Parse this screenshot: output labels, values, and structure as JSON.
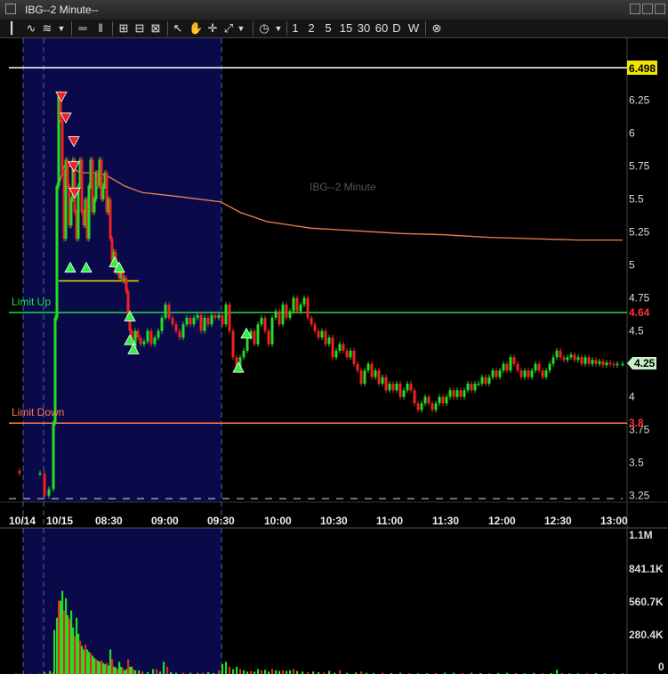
{
  "window": {
    "title": "IBG--2 Minute--"
  },
  "toolbar": {
    "intervals": [
      "1",
      "2",
      "5",
      "15",
      "30",
      "60",
      "D",
      "W"
    ]
  },
  "chart_data": {
    "type": "candlestick",
    "watermark": "IBG--2 Minute",
    "price_axis": {
      "ticks": [
        "6.25",
        "6",
        "5.75",
        "5.5",
        "5.25",
        "5",
        "4.75",
        "4.5",
        "4.25",
        "4",
        "3.75",
        "3.5",
        "3.25"
      ],
      "range": [
        3.2,
        6.55
      ]
    },
    "time_axis": {
      "labels": [
        "10/14",
        "10/15",
        "08:30",
        "09:00",
        "09:30",
        "10:00",
        "10:30",
        "11:00",
        "11:30",
        "12:00",
        "12:30",
        "13:00"
      ]
    },
    "volume_axis": {
      "ticks": [
        "1.1M",
        "841.1K",
        "560.7K",
        "280.4K",
        "0"
      ],
      "max": 1100000
    },
    "levels": {
      "high": {
        "value": 6.498,
        "label": "6.498",
        "color": "#ffffff"
      },
      "limit_up": {
        "value": 4.64,
        "label": "4.64",
        "name": "Limit Up",
        "color": "#22dd44"
      },
      "limit_down": {
        "value": 3.8,
        "label": "3.8",
        "name": "Limit Down",
        "color": "#ff7a4a"
      },
      "last": {
        "value": 4.25,
        "label": "4.25"
      }
    },
    "price_path": [
      [
        10,
        3.44
      ],
      [
        22,
        3.42
      ],
      [
        45,
        3.42
      ],
      [
        50,
        3.25
      ],
      [
        55,
        3.3
      ],
      [
        60,
        3.8
      ],
      [
        62,
        4.6
      ],
      [
        64,
        5.6
      ],
      [
        66,
        6.3
      ],
      [
        68,
        6.1
      ],
      [
        70,
        5.7
      ],
      [
        72,
        5.2
      ],
      [
        74,
        5.8
      ],
      [
        76,
        5.6
      ],
      [
        78,
        5.3
      ],
      [
        80,
        5.5
      ],
      [
        82,
        5.8
      ],
      [
        84,
        5.4
      ],
      [
        86,
        5.2
      ],
      [
        88,
        5.6
      ],
      [
        90,
        5.8
      ],
      [
        92,
        5.4
      ],
      [
        94,
        5.3
      ],
      [
        96,
        5.5
      ],
      [
        98,
        5.2
      ],
      [
        100,
        5.6
      ],
      [
        102,
        5.8
      ],
      [
        104,
        5.4
      ],
      [
        106,
        5.5
      ],
      [
        108,
        5.7
      ],
      [
        110,
        5.6
      ],
      [
        112,
        5.8
      ],
      [
        114,
        5.5
      ],
      [
        116,
        5.6
      ],
      [
        118,
        5.7
      ],
      [
        120,
        5.4
      ],
      [
        122,
        5.5
      ],
      [
        124,
        5.2
      ],
      [
        126,
        5.0
      ],
      [
        128,
        5.1
      ],
      [
        130,
        4.95
      ],
      [
        132,
        5.0
      ],
      [
        134,
        4.9
      ],
      [
        136,
        4.95
      ],
      [
        138,
        4.88
      ],
      [
        140,
        4.9
      ],
      [
        142,
        4.8
      ],
      [
        144,
        4.6
      ],
      [
        146,
        4.5
      ],
      [
        148,
        4.4
      ],
      [
        150,
        4.35
      ],
      [
        152,
        4.5
      ],
      [
        155,
        4.45
      ],
      [
        158,
        4.4
      ],
      [
        162,
        4.42
      ],
      [
        166,
        4.5
      ],
      [
        170,
        4.4
      ],
      [
        174,
        4.45
      ],
      [
        178,
        4.5
      ],
      [
        182,
        4.6
      ],
      [
        186,
        4.7
      ],
      [
        190,
        4.6
      ],
      [
        194,
        4.55
      ],
      [
        198,
        4.5
      ],
      [
        202,
        4.45
      ],
      [
        206,
        4.55
      ],
      [
        210,
        4.6
      ],
      [
        214,
        4.55
      ],
      [
        218,
        4.6
      ],
      [
        222,
        4.62
      ],
      [
        226,
        4.5
      ],
      [
        230,
        4.6
      ],
      [
        234,
        4.55
      ],
      [
        238,
        4.62
      ],
      [
        242,
        4.6
      ],
      [
        246,
        4.62
      ],
      [
        250,
        4.55
      ],
      [
        254,
        4.7
      ],
      [
        258,
        4.5
      ],
      [
        262,
        4.3
      ],
      [
        266,
        4.2
      ],
      [
        270,
        4.3
      ],
      [
        274,
        4.35
      ],
      [
        278,
        4.45
      ],
      [
        282,
        4.5
      ],
      [
        286,
        4.4
      ],
      [
        290,
        4.55
      ],
      [
        294,
        4.6
      ],
      [
        298,
        4.5
      ],
      [
        302,
        4.4
      ],
      [
        306,
        4.6
      ],
      [
        310,
        4.65
      ],
      [
        314,
        4.55
      ],
      [
        318,
        4.7
      ],
      [
        322,
        4.6
      ],
      [
        326,
        4.65
      ],
      [
        330,
        4.75
      ],
      [
        334,
        4.65
      ],
      [
        338,
        4.7
      ],
      [
        342,
        4.75
      ],
      [
        346,
        4.6
      ],
      [
        350,
        4.55
      ],
      [
        354,
        4.5
      ],
      [
        358,
        4.45
      ],
      [
        362,
        4.5
      ],
      [
        366,
        4.4
      ],
      [
        370,
        4.45
      ],
      [
        374,
        4.3
      ],
      [
        378,
        4.35
      ],
      [
        382,
        4.4
      ],
      [
        386,
        4.35
      ],
      [
        390,
        4.3
      ],
      [
        394,
        4.35
      ],
      [
        398,
        4.25
      ],
      [
        402,
        4.2
      ],
      [
        406,
        4.1
      ],
      [
        410,
        4.2
      ],
      [
        414,
        4.25
      ],
      [
        418,
        4.15
      ],
      [
        422,
        4.2
      ],
      [
        426,
        4.1
      ],
      [
        430,
        4.15
      ],
      [
        434,
        4.05
      ],
      [
        438,
        4.1
      ],
      [
        442,
        4.05
      ],
      [
        446,
        4.1
      ],
      [
        450,
        4.0
      ],
      [
        454,
        4.05
      ],
      [
        458,
        4.1
      ],
      [
        462,
        4.05
      ],
      [
        466,
        3.95
      ],
      [
        470,
        3.9
      ],
      [
        474,
        3.95
      ],
      [
        478,
        4.0
      ],
      [
        482,
        3.95
      ],
      [
        486,
        3.9
      ],
      [
        490,
        3.95
      ],
      [
        494,
        4.0
      ],
      [
        498,
        3.95
      ],
      [
        502,
        4.0
      ],
      [
        506,
        4.05
      ],
      [
        510,
        4.0
      ],
      [
        514,
        4.05
      ],
      [
        518,
        4.0
      ],
      [
        522,
        4.05
      ],
      [
        526,
        4.1
      ],
      [
        530,
        4.05
      ],
      [
        534,
        4.1
      ],
      [
        538,
        4.1
      ],
      [
        542,
        4.15
      ],
      [
        546,
        4.1
      ],
      [
        550,
        4.15
      ],
      [
        554,
        4.2
      ],
      [
        558,
        4.15
      ],
      [
        562,
        4.2
      ],
      [
        566,
        4.25
      ],
      [
        570,
        4.2
      ],
      [
        574,
        4.3
      ],
      [
        578,
        4.25
      ],
      [
        582,
        4.2
      ],
      [
        586,
        4.15
      ],
      [
        590,
        4.2
      ],
      [
        594,
        4.15
      ],
      [
        598,
        4.2
      ],
      [
        602,
        4.25
      ],
      [
        606,
        4.2
      ],
      [
        610,
        4.15
      ],
      [
        614,
        4.2
      ],
      [
        618,
        4.25
      ],
      [
        622,
        4.3
      ],
      [
        626,
        4.35
      ],
      [
        630,
        4.3
      ],
      [
        634,
        4.28
      ],
      [
        638,
        4.3
      ],
      [
        642,
        4.32
      ],
      [
        646,
        4.28
      ],
      [
        650,
        4.3
      ],
      [
        654,
        4.25
      ],
      [
        658,
        4.3
      ],
      [
        662,
        4.25
      ],
      [
        666,
        4.28
      ],
      [
        670,
        4.25
      ],
      [
        674,
        4.27
      ],
      [
        678,
        4.24
      ],
      [
        682,
        4.26
      ],
      [
        686,
        4.25
      ],
      [
        690,
        4.24
      ],
      [
        694,
        4.25
      ],
      [
        700,
        4.25
      ]
    ],
    "vwap_path": [
      [
        66,
        5.6
      ],
      [
        72,
        5.75
      ],
      [
        80,
        5.75
      ],
      [
        90,
        5.7
      ],
      [
        100,
        5.7
      ],
      [
        110,
        5.7
      ],
      [
        120,
        5.68
      ],
      [
        140,
        5.6
      ],
      [
        160,
        5.55
      ],
      [
        200,
        5.52
      ],
      [
        248,
        5.48
      ],
      [
        270,
        5.4
      ],
      [
        300,
        5.33
      ],
      [
        350,
        5.28
      ],
      [
        400,
        5.26
      ],
      [
        450,
        5.24
      ],
      [
        500,
        5.23
      ],
      [
        550,
        5.21
      ],
      [
        600,
        5.2
      ],
      [
        650,
        5.19
      ],
      [
        700,
        5.19
      ]
    ],
    "buy_signals": [
      [
        79,
        4.98
      ],
      [
        97,
        4.98
      ],
      [
        129,
        5.02
      ],
      [
        134,
        4.98
      ],
      [
        146,
        4.61
      ],
      [
        146,
        4.43
      ],
      [
        150,
        4.36
      ],
      [
        268,
        4.22
      ],
      [
        277,
        4.48
      ]
    ],
    "sell_signals": [
      [
        69,
        6.28
      ],
      [
        74,
        6.12
      ],
      [
        83,
        5.94
      ],
      [
        83,
        5.75
      ],
      [
        84,
        5.55
      ]
    ],
    "volume_bars": [
      [
        18,
        3
      ],
      [
        22,
        2
      ],
      [
        26,
        2
      ],
      [
        34,
        2
      ],
      [
        44,
        3
      ],
      [
        50,
        12
      ],
      [
        56,
        25
      ],
      [
        59,
        12
      ],
      [
        61,
        360
      ],
      [
        64,
        460
      ],
      [
        66,
        600
      ],
      [
        68,
        600
      ],
      [
        70,
        680
      ],
      [
        72,
        520
      ],
      [
        74,
        620
      ],
      [
        76,
        480
      ],
      [
        78,
        450
      ],
      [
        80,
        520
      ],
      [
        82,
        380
      ],
      [
        84,
        310
      ],
      [
        86,
        460
      ],
      [
        88,
        330
      ],
      [
        90,
        270
      ],
      [
        92,
        230
      ],
      [
        94,
        200
      ],
      [
        96,
        240
      ],
      [
        98,
        200
      ],
      [
        100,
        180
      ],
      [
        102,
        170
      ],
      [
        104,
        150
      ],
      [
        106,
        130
      ],
      [
        108,
        120
      ],
      [
        110,
        110
      ],
      [
        112,
        100
      ],
      [
        114,
        110
      ],
      [
        116,
        90
      ],
      [
        118,
        80
      ],
      [
        120,
        90
      ],
      [
        122,
        70
      ],
      [
        124,
        200
      ],
      [
        126,
        120
      ],
      [
        128,
        60
      ],
      [
        130,
        55
      ],
      [
        132,
        40
      ],
      [
        134,
        100
      ],
      [
        136,
        60
      ],
      [
        138,
        50
      ],
      [
        140,
        30
      ],
      [
        142,
        40
      ],
      [
        144,
        120
      ],
      [
        146,
        60
      ],
      [
        148,
        60
      ],
      [
        150,
        40
      ],
      [
        152,
        30
      ],
      [
        156,
        30
      ],
      [
        160,
        20
      ],
      [
        166,
        15
      ],
      [
        172,
        40
      ],
      [
        176,
        40
      ],
      [
        180,
        20
      ],
      [
        184,
        100
      ],
      [
        188,
        60
      ],
      [
        192,
        15
      ],
      [
        198,
        10
      ],
      [
        206,
        10
      ],
      [
        214,
        10
      ],
      [
        222,
        8
      ],
      [
        228,
        10
      ],
      [
        234,
        15
      ],
      [
        240,
        8
      ],
      [
        246,
        30
      ],
      [
        250,
        80
      ],
      [
        254,
        100
      ],
      [
        258,
        60
      ],
      [
        262,
        40
      ],
      [
        266,
        60
      ],
      [
        270,
        40
      ],
      [
        274,
        30
      ],
      [
        278,
        20
      ],
      [
        282,
        25
      ],
      [
        286,
        20
      ],
      [
        290,
        40
      ],
      [
        294,
        30
      ],
      [
        298,
        35
      ],
      [
        302,
        20
      ],
      [
        306,
        40
      ],
      [
        310,
        30
      ],
      [
        314,
        25
      ],
      [
        318,
        30
      ],
      [
        322,
        25
      ],
      [
        326,
        30
      ],
      [
        330,
        40
      ],
      [
        334,
        25
      ],
      [
        340,
        20
      ],
      [
        346,
        15
      ],
      [
        352,
        20
      ],
      [
        358,
        15
      ],
      [
        364,
        12
      ],
      [
        370,
        25
      ],
      [
        376,
        10
      ],
      [
        382,
        30
      ],
      [
        390,
        10
      ],
      [
        400,
        12
      ],
      [
        406,
        20
      ],
      [
        412,
        10
      ],
      [
        420,
        8
      ],
      [
        430,
        10
      ],
      [
        440,
        8
      ],
      [
        450,
        10
      ],
      [
        460,
        8
      ],
      [
        470,
        6
      ],
      [
        480,
        6
      ],
      [
        490,
        8
      ],
      [
        500,
        10
      ],
      [
        510,
        10
      ],
      [
        520,
        8
      ],
      [
        530,
        10
      ],
      [
        540,
        8
      ],
      [
        550,
        6
      ],
      [
        560,
        8
      ],
      [
        570,
        10
      ],
      [
        580,
        8
      ],
      [
        590,
        6
      ],
      [
        600,
        8
      ],
      [
        610,
        6
      ],
      [
        620,
        8
      ],
      [
        626,
        35
      ],
      [
        632,
        8
      ],
      [
        640,
        6
      ],
      [
        650,
        6
      ],
      [
        660,
        6
      ],
      [
        670,
        8
      ],
      [
        680,
        6
      ],
      [
        690,
        6
      ],
      [
        700,
        6
      ]
    ]
  }
}
